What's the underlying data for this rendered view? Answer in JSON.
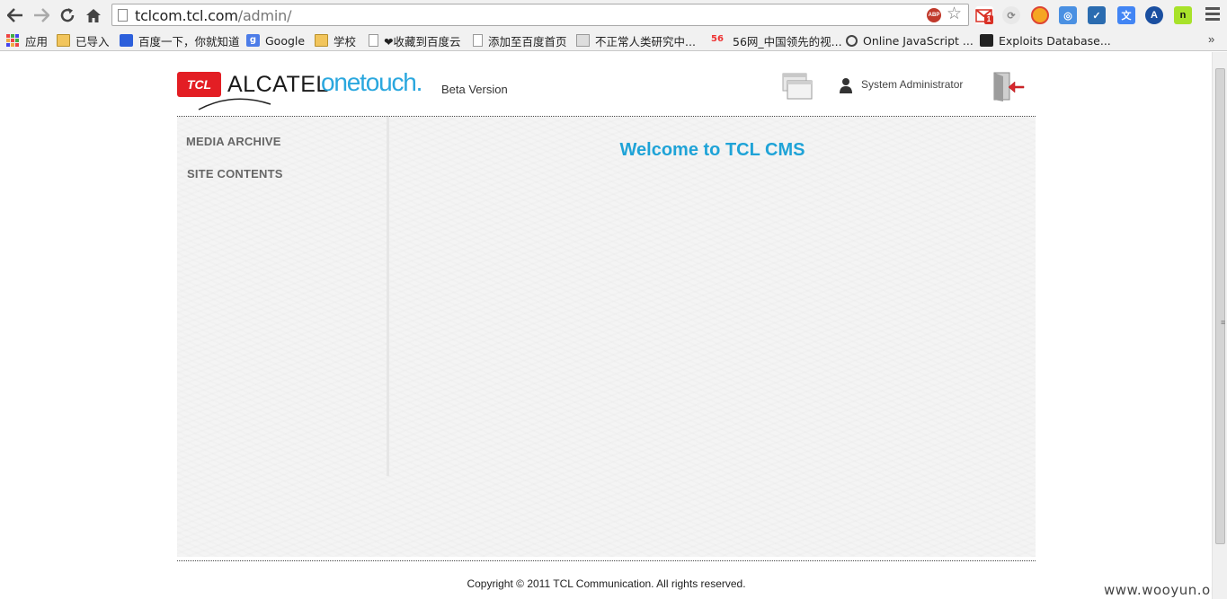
{
  "browser": {
    "url_host": "tclcom.tcl.com",
    "url_path": "/admin/",
    "abp_label": "ABP",
    "gmail_badge": "1",
    "bookmarks": [
      {
        "label": "应用",
        "icon": "apps-icon"
      },
      {
        "label": "已导入",
        "icon": "folder-icon"
      },
      {
        "label": "百度一下，你就知道",
        "icon": "baidu-icon"
      },
      {
        "label": "Google",
        "icon": "google-icon"
      },
      {
        "label": "学校",
        "icon": "folder-icon"
      },
      {
        "label": "❤收藏到百度云",
        "icon": "page-icon"
      },
      {
        "label": "添加至百度首页",
        "icon": "page-icon"
      },
      {
        "label": "不正常人类研究中...",
        "icon": "site-icon"
      },
      {
        "label": "56网_中国领先的视...",
        "icon": "56-icon"
      },
      {
        "label": "Online JavaScript ...",
        "icon": "clock-icon"
      },
      {
        "label": "Exploits Database...",
        "icon": "exploitdb-icon"
      }
    ],
    "bookmarks_more": "»"
  },
  "header": {
    "logo_tcl": "TCL",
    "logo_alcatel": "ALCATEL",
    "logo_onetouch": "onetouch.",
    "beta_label": "Beta Version",
    "user_name": "System Administrator"
  },
  "sidebar": {
    "items": [
      {
        "label": "MEDIA ARCHIVE"
      },
      {
        "label": "SITE CONTENTS"
      }
    ]
  },
  "main": {
    "welcome": "Welcome to TCL CMS"
  },
  "footer": {
    "copyright": "Copyright © 2011 TCL Communication. All rights reserved."
  },
  "watermark": "www.wooyun.org",
  "colors": {
    "accent": "#1fa3d7",
    "tcl_red": "#e31e24",
    "onetouch_blue": "#2aa7de"
  }
}
